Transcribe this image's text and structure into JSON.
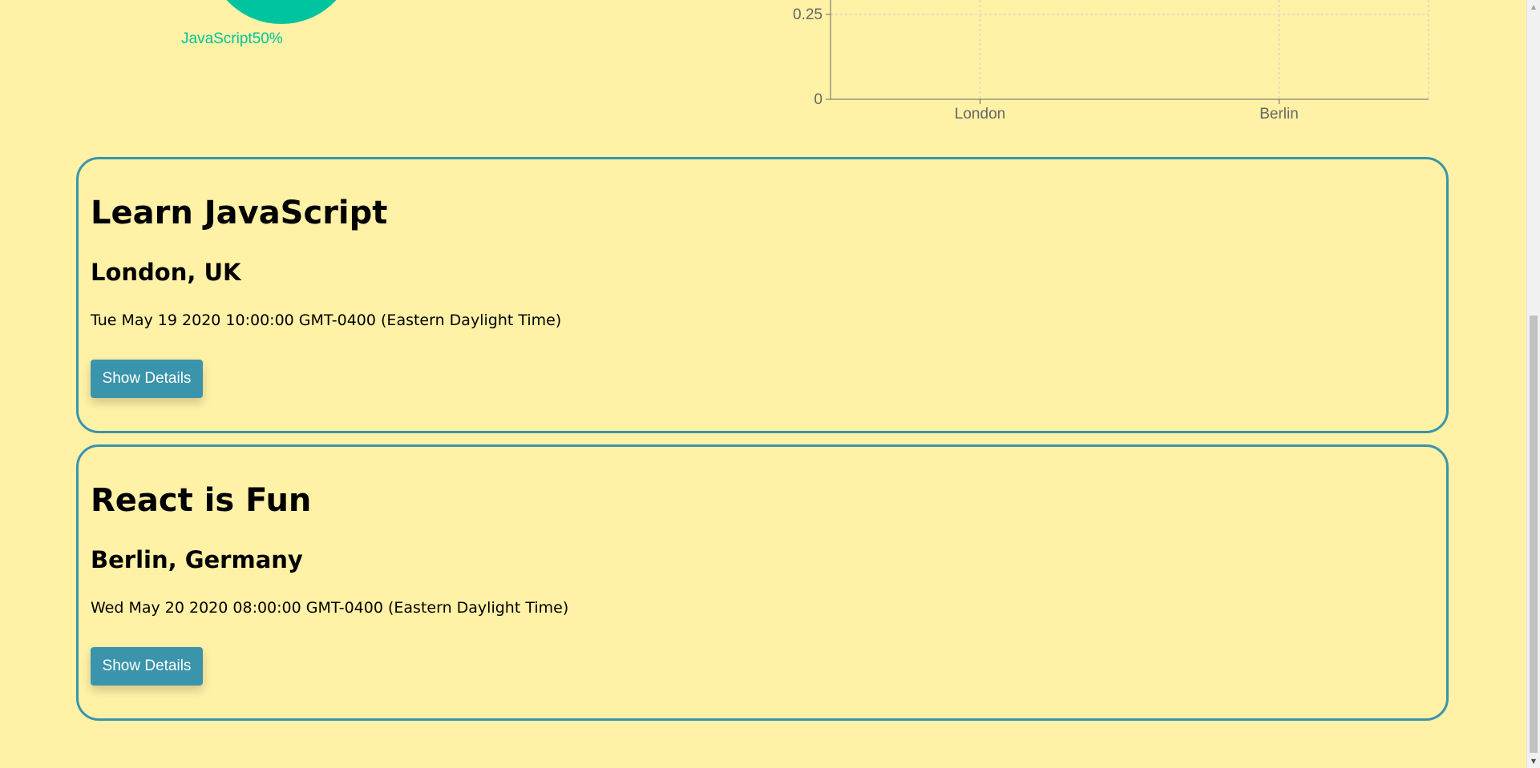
{
  "pie": {
    "label": "JavaScript50%",
    "color": "#00c49f"
  },
  "chart_data": [
    {
      "type": "pie",
      "slices": [
        {
          "name": "JavaScript",
          "value": 50
        }
      ]
    },
    {
      "type": "bar",
      "categories": [
        "London",
        "Berlin"
      ],
      "y_ticks": [
        "0",
        "0.25"
      ],
      "grid": true
    }
  ],
  "events": [
    {
      "title": "Learn JavaScript",
      "location": "London, UK",
      "date": "Tue May 19 2020 10:00:00 GMT-0400 (Eastern Daylight Time)",
      "button_label": "Show Details"
    },
    {
      "title": "React is Fun",
      "location": "Berlin, Germany",
      "date": "Wed May 20 2020 08:00:00 GMT-0400 (Eastern Daylight Time)",
      "button_label": "Show Details"
    }
  ],
  "colors": {
    "background": "#fff1a6",
    "accent": "#3a94ab",
    "pie": "#00c49f",
    "axis": "#666666"
  },
  "scrollbar": {
    "up_icon": "triangle-up-icon",
    "down_icon": "triangle-down-icon"
  }
}
